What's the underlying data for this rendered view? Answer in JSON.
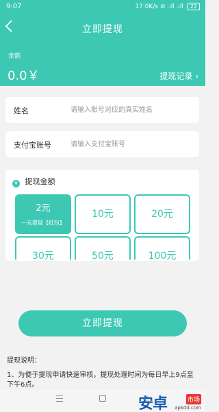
{
  "status_bar": {
    "time": "9:07",
    "right": "17.0K/s ⊘ .ıll .ıll",
    "battery": "22"
  },
  "header": {
    "title": "立即提现",
    "balance_label": "余额",
    "balance_value": "0.0￥",
    "history_link": "提现记录 ›"
  },
  "form": {
    "name": {
      "label": "姓名",
      "placeholder": "请输入账号对应的真实姓名"
    },
    "alipay": {
      "label": "支付宝账号",
      "placeholder": "请输入支付宝账号"
    }
  },
  "amount": {
    "title": "提现金额",
    "coin_glyph": "¥",
    "options": [
      {
        "amount": "2元",
        "sub": "一元提现【红包】",
        "selected": true
      },
      {
        "amount": "10元"
      },
      {
        "amount": "20元"
      },
      {
        "amount": "30元"
      },
      {
        "amount": "50元"
      },
      {
        "amount": "100元"
      }
    ]
  },
  "submit_label": "立即提现",
  "notes": {
    "title": "提现说明：",
    "text": "1、为便于提现申请快速审核，提现处理时间为每日早上9点至下午6点。"
  },
  "nav": {
    "back": "◁"
  },
  "watermark": {
    "main": "安卓",
    "badge": "市场",
    "url": "apkdd.com"
  },
  "colors": {
    "accent": "#3dc8b3",
    "background": "#f2f2f2"
  }
}
